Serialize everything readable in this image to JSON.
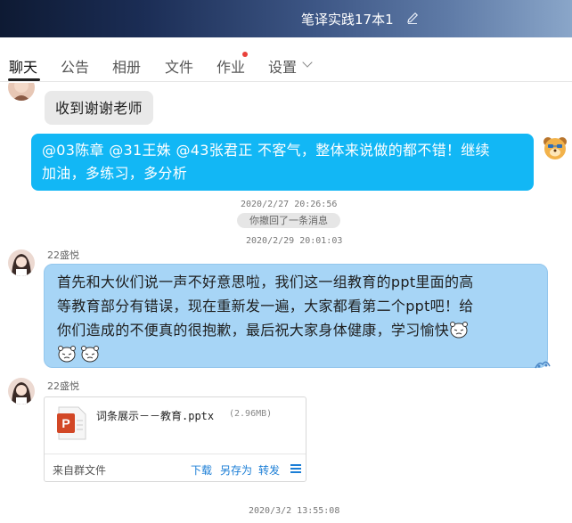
{
  "window": {
    "title": "笔译实践17本1"
  },
  "tabs": [
    {
      "label": "聊天",
      "active": true
    },
    {
      "label": "公告"
    },
    {
      "label": "相册"
    },
    {
      "label": "文件"
    },
    {
      "label": "作业",
      "has_notification": true
    },
    {
      "label": "设置"
    }
  ],
  "messages": {
    "m1": {
      "text": "收到谢谢老师"
    },
    "m2": {
      "text_line1": "@03陈章 @31王姝 @43张君正 不客气，整体来说做的都不错！继续",
      "text_line2": "加油，多练习，多分析"
    },
    "t1": "2020/2/27 20:26:56",
    "recall": "你撤回了一条消息",
    "t2": "2020/2/29 20:01:03",
    "m3": {
      "sender": "22盛悦",
      "line1": "首先和大伙们说一声不好意思啦，我们这一组教育的ppt里面的高",
      "line2": "等教育部分有错误，现在重新发一遍，大家都看第二个ppt吧！给",
      "line3": "你们造成的不便真的很抱歉，最后祝大家身体健康，学习愉快"
    },
    "m4": {
      "sender": "22盛悦",
      "file_name": "词条展示－－教育.pptx",
      "file_size": "(2.96MB)",
      "source": "来自群文件",
      "action_download": "下载",
      "action_save_as": "另存为",
      "action_forward": "转发"
    },
    "t3": "2020/3/2 13:55:08"
  },
  "colors": {
    "teacher_bubble": "#12b7f5",
    "self_bubble": "#a7d5f6",
    "link": "#1b7ed6",
    "notification": "#e9413a",
    "ppt_icon": "#d24726"
  }
}
